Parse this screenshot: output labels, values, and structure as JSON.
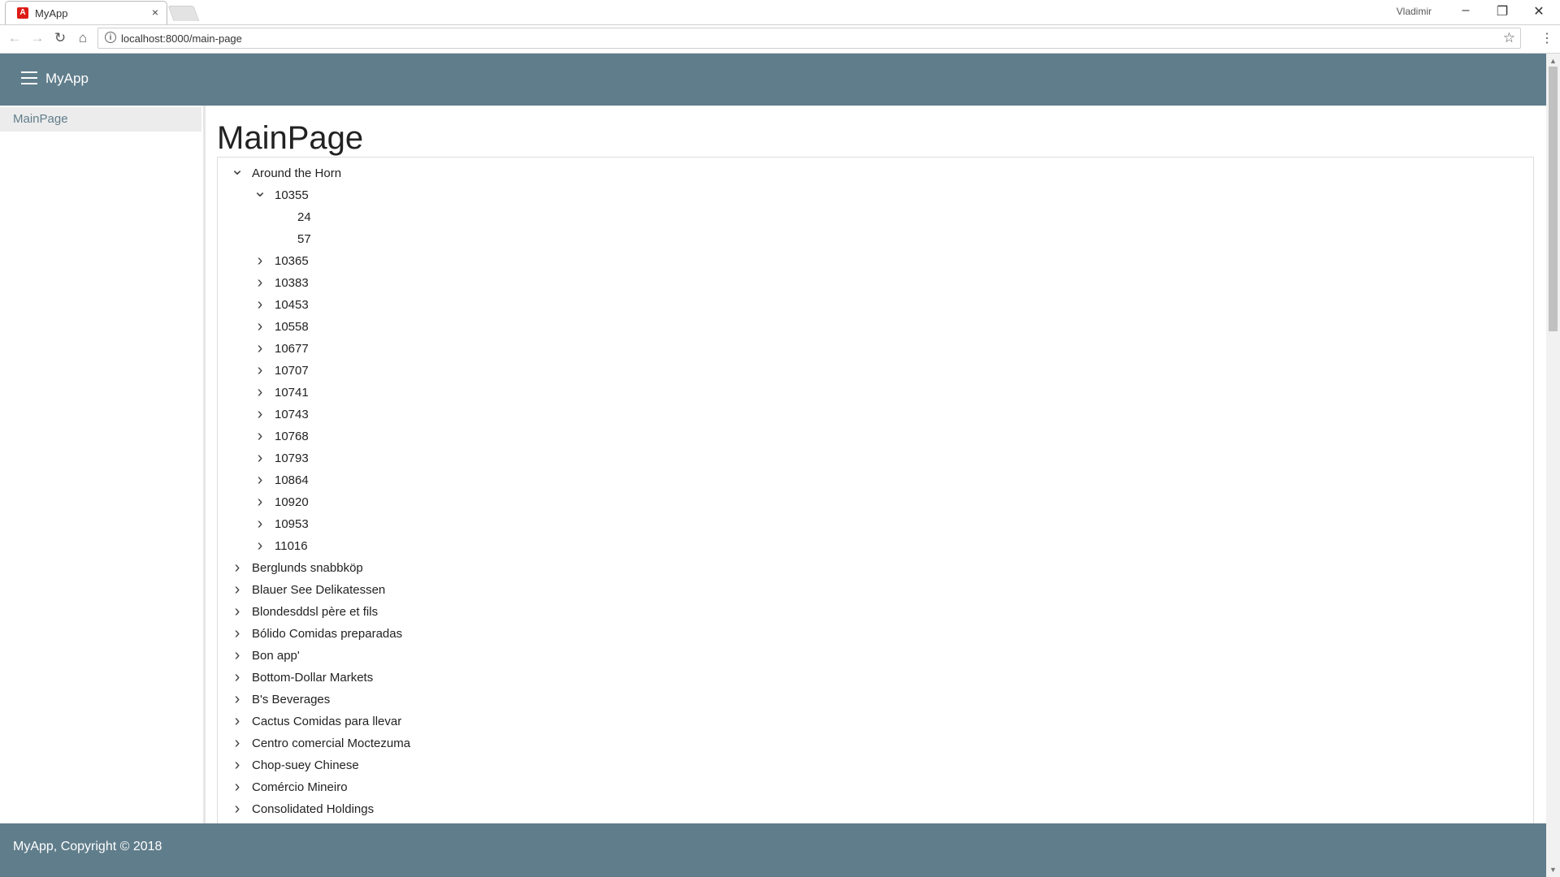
{
  "browser": {
    "tab_title": "MyApp",
    "tab_close": "×",
    "user": "Vladimir",
    "url": "localhost:8000/main-page"
  },
  "app": {
    "title": "MyApp",
    "sidebar": {
      "items": [
        {
          "label": "MainPage"
        }
      ]
    },
    "page_title": "MainPage",
    "footer": "MyApp, Copyright © 2018"
  },
  "tree": {
    "rows": [
      {
        "label": "Around the Horn",
        "level": 0,
        "state": "expanded"
      },
      {
        "label": "10355",
        "level": 1,
        "state": "expanded"
      },
      {
        "label": "24",
        "level": 2,
        "state": "leaf"
      },
      {
        "label": "57",
        "level": 2,
        "state": "leaf"
      },
      {
        "label": "10365",
        "level": 1,
        "state": "collapsed"
      },
      {
        "label": "10383",
        "level": 1,
        "state": "collapsed"
      },
      {
        "label": "10453",
        "level": 1,
        "state": "collapsed"
      },
      {
        "label": "10558",
        "level": 1,
        "state": "collapsed"
      },
      {
        "label": "10677",
        "level": 1,
        "state": "collapsed"
      },
      {
        "label": "10707",
        "level": 1,
        "state": "collapsed"
      },
      {
        "label": "10741",
        "level": 1,
        "state": "collapsed"
      },
      {
        "label": "10743",
        "level": 1,
        "state": "collapsed"
      },
      {
        "label": "10768",
        "level": 1,
        "state": "collapsed"
      },
      {
        "label": "10793",
        "level": 1,
        "state": "collapsed"
      },
      {
        "label": "10864",
        "level": 1,
        "state": "collapsed"
      },
      {
        "label": "10920",
        "level": 1,
        "state": "collapsed"
      },
      {
        "label": "10953",
        "level": 1,
        "state": "collapsed"
      },
      {
        "label": "11016",
        "level": 1,
        "state": "collapsed"
      },
      {
        "label": "Berglunds snabbköp",
        "level": 0,
        "state": "collapsed"
      },
      {
        "label": "Blauer See Delikatessen",
        "level": 0,
        "state": "collapsed"
      },
      {
        "label": "Blondesddsl père et fils",
        "level": 0,
        "state": "collapsed"
      },
      {
        "label": "Bólido Comidas preparadas",
        "level": 0,
        "state": "collapsed"
      },
      {
        "label": "Bon app'",
        "level": 0,
        "state": "collapsed"
      },
      {
        "label": "Bottom-Dollar Markets",
        "level": 0,
        "state": "collapsed"
      },
      {
        "label": "B's Beverages",
        "level": 0,
        "state": "collapsed"
      },
      {
        "label": "Cactus Comidas para llevar",
        "level": 0,
        "state": "collapsed"
      },
      {
        "label": "Centro comercial Moctezuma",
        "level": 0,
        "state": "collapsed"
      },
      {
        "label": "Chop-suey Chinese",
        "level": 0,
        "state": "collapsed"
      },
      {
        "label": "Comércio Mineiro",
        "level": 0,
        "state": "collapsed"
      },
      {
        "label": "Consolidated Holdings",
        "level": 0,
        "state": "collapsed"
      }
    ]
  }
}
